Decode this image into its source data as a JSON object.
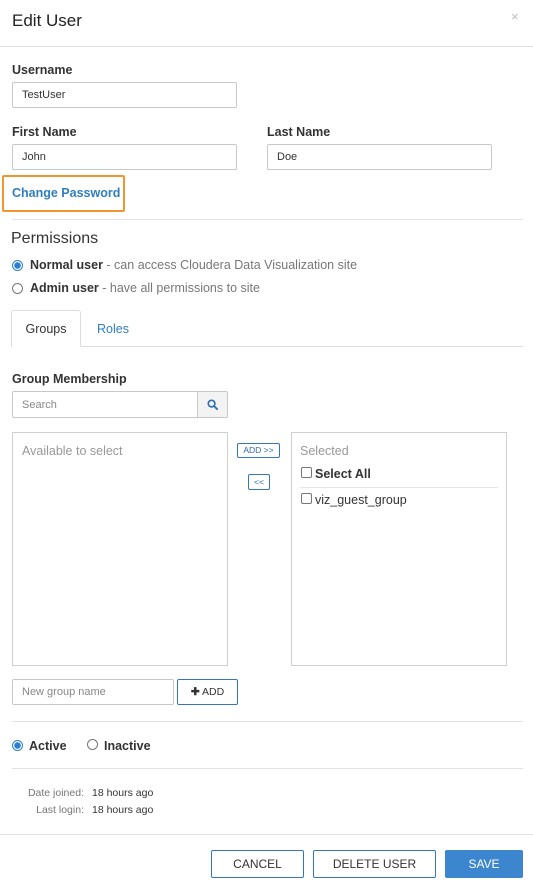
{
  "dialog": {
    "title": "Edit User",
    "close_glyph": "×"
  },
  "form": {
    "username_label": "Username",
    "username_value": "TestUser",
    "first_name_label": "First Name",
    "first_name_value": "John",
    "last_name_label": "Last Name",
    "last_name_value": "Doe",
    "change_password": "Change Password"
  },
  "permissions": {
    "title": "Permissions",
    "options": [
      {
        "name": "Normal user",
        "desc": " - can access Cloudera Data Visualization site",
        "checked": true
      },
      {
        "name": "Admin user",
        "desc": " - have all permissions to site",
        "checked": false
      }
    ]
  },
  "tabs": [
    {
      "label": "Groups",
      "active": true
    },
    {
      "label": "Roles",
      "active": false
    }
  ],
  "groups": {
    "membership_label": "Group Membership",
    "search_placeholder": "Search",
    "available_label": "Available to select",
    "add_label": "ADD >>",
    "remove_label": "<<",
    "selected_label": "Selected",
    "select_all_label": "Select All",
    "selected_items": [
      "viz_guest_group"
    ],
    "new_group_placeholder": "New group name",
    "add_group_label": "ADD",
    "add_group_icon": "plus-icon"
  },
  "status": {
    "options": [
      {
        "label": "Active",
        "checked": true
      },
      {
        "label": "Inactive",
        "checked": false
      }
    ]
  },
  "meta": {
    "date_joined_label": "Date joined:",
    "date_joined_value": "18 hours ago",
    "last_login_label": "Last login:",
    "last_login_value": "18 hours ago"
  },
  "footer": {
    "cancel": "CANCEL",
    "delete": "DELETE USER",
    "save": "SAVE"
  },
  "colors": {
    "accent": "#2f7fbf",
    "primary_button": "#3b86cf",
    "highlight_outline": "#f0962e"
  }
}
